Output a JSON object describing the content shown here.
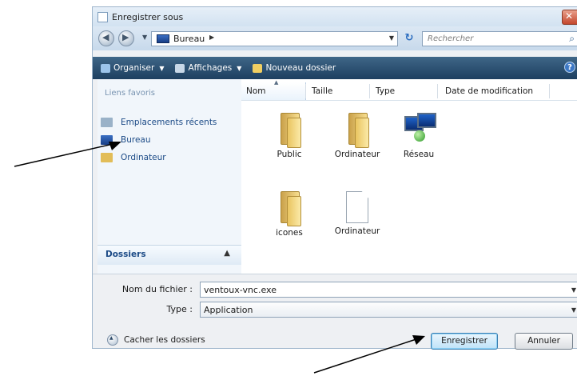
{
  "window": {
    "title": "Enregistrer sous"
  },
  "address_bar": {
    "location": "Bureau",
    "search_placeholder": "Rechercher"
  },
  "toolbar": {
    "organize": "Organiser",
    "views": "Affichages",
    "new_folder": "Nouveau dossier"
  },
  "left_pane": {
    "heading": "Liens favoris",
    "items": [
      {
        "label": "Emplacements récents",
        "icon": "recent-places-icon"
      },
      {
        "label": "Bureau",
        "icon": "desktop-icon"
      },
      {
        "label": "Ordinateur",
        "icon": "computer-folder-icon"
      }
    ],
    "folders_label": "Dossiers"
  },
  "columns": [
    "Nom",
    "Taille",
    "Type",
    "Date de modification"
  ],
  "files": [
    {
      "name": "Public",
      "icon": "folder-icon"
    },
    {
      "name": "Ordinateur",
      "icon": "folder-icon"
    },
    {
      "name": "Réseau",
      "icon": "network-icon"
    },
    {
      "name": "icones",
      "icon": "folder-icon"
    },
    {
      "name": "Ordinateur",
      "icon": "document-icon"
    }
  ],
  "form": {
    "filename_label": "Nom du fichier :",
    "filename_value": "ventoux-vnc.exe",
    "type_label": "Type :",
    "type_value": "Application"
  },
  "footer": {
    "hide_folders": "Cacher les dossiers",
    "save": "Enregistrer",
    "cancel": "Annuler"
  },
  "colors": {
    "toolbar": "#1d3f60",
    "link": "#1b4a86",
    "accent": "#3c7fb1"
  }
}
